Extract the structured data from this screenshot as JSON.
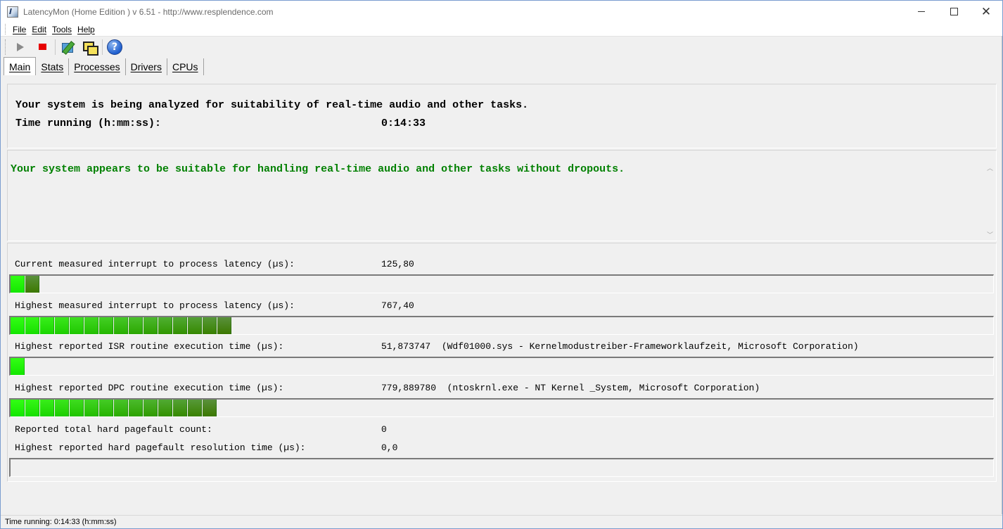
{
  "window": {
    "title": "LatencyMon  (Home Edition )  v 6.51 - http://www.resplendence.com",
    "controls": {
      "minimize": "minimize",
      "maximize": "maximize",
      "close": "close"
    }
  },
  "menu": [
    {
      "label": "File"
    },
    {
      "label": "Edit"
    },
    {
      "label": "Tools"
    },
    {
      "label": "Help"
    }
  ],
  "toolbar": {
    "icons": [
      "play-icon",
      "stop-icon",
      "tools-icon",
      "windows-icon",
      "help-icon"
    ],
    "stop_color": "#e60000"
  },
  "tabs": [
    {
      "label": "Main",
      "active": true
    },
    {
      "label": "Stats",
      "active": false
    },
    {
      "label": "Processes",
      "active": false
    },
    {
      "label": "Drivers",
      "active": false
    },
    {
      "label": "CPUs",
      "active": false
    }
  ],
  "analysis": {
    "status_line": "Your system is being analyzed for suitability of real-time audio and other tasks.",
    "time_label": "Time running (h:mm:ss):",
    "time_value": "0:14:33"
  },
  "verdict": {
    "text": "Your system appears to be suitable for handling real-time audio and other tasks without dropouts.",
    "color": "#008000"
  },
  "metrics": {
    "current_latency": {
      "label": "Current measured interrupt to process latency (µs):",
      "value": "125,80",
      "bar_segments": 2
    },
    "highest_latency": {
      "label": "Highest measured interrupt to process latency (µs):",
      "value": "767,40",
      "bar_segments": 15
    },
    "isr": {
      "label": "Highest reported ISR routine execution time (µs):",
      "value": "51,873747  (Wdf01000.sys - Kernelmodustreiber-Frameworklaufzeit, Microsoft Corporation)",
      "bar_segments": 1
    },
    "dpc": {
      "label": "Highest reported DPC routine execution time (µs):",
      "value": "779,889780  (ntoskrnl.exe - NT Kernel _System, Microsoft Corporation)",
      "bar_segments": 14
    },
    "pagefault_count": {
      "label": "Reported total hard pagefault count:",
      "value": "0"
    },
    "pagefault_time": {
      "label": "Highest reported hard pagefault resolution time (µs):",
      "value": "0,0",
      "bar_segments": 0
    }
  },
  "statusbar": {
    "text": "Time running: 0:14:33  (h:mm:ss)"
  }
}
